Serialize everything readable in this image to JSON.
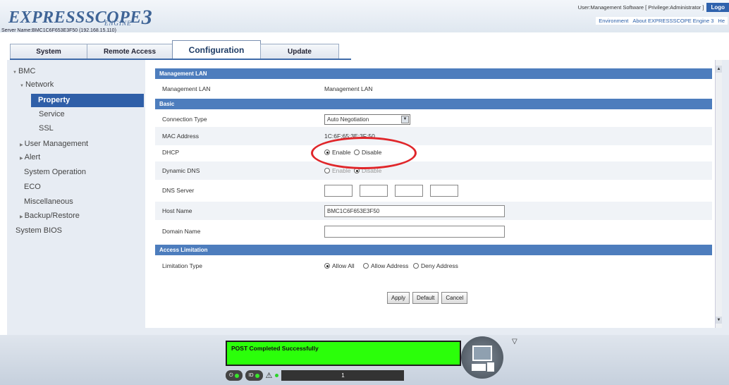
{
  "header": {
    "logo_main": "EXPRESSSCOPE",
    "logo_num": "3",
    "logo_sub": "ENGINE",
    "server_name": "Server Name:BMC1C6F653E3F50 (192.168.15.110)",
    "user_info": "User:Management Software [ Privilege:Administrator ]",
    "logout_label": "Logo",
    "links": [
      "Environment",
      "About EXPRESSSCOPE Engine 3",
      "He"
    ]
  },
  "tabs": [
    {
      "label": "System"
    },
    {
      "label": "Remote Access"
    },
    {
      "label": "Configuration"
    },
    {
      "label": "Update"
    }
  ],
  "sidebar": {
    "items": [
      {
        "label": "BMC"
      },
      {
        "label": "Network"
      },
      {
        "label": "Property"
      },
      {
        "label": "Service"
      },
      {
        "label": "SSL"
      },
      {
        "label": "User Management"
      },
      {
        "label": "Alert"
      },
      {
        "label": "System Operation"
      },
      {
        "label": "ECO"
      },
      {
        "label": "Miscellaneous"
      },
      {
        "label": "Backup/Restore"
      },
      {
        "label": "System BIOS"
      }
    ]
  },
  "content": {
    "sections": [
      {
        "title": "Management LAN"
      },
      {
        "title": "Basic"
      },
      {
        "title": "Access Limitation"
      }
    ],
    "management_lan": {
      "label": "Management LAN",
      "value": "Management LAN"
    },
    "connection_type": {
      "label": "Connection Type",
      "value": "Auto Negotiation"
    },
    "mac_address": {
      "label": "MAC Address",
      "value": "1C:6F:65:3E:3F:50"
    },
    "dhcp": {
      "label": "DHCP",
      "options": [
        "Enable",
        "Disable"
      ],
      "selected": "Enable"
    },
    "dynamic_dns": {
      "label": "Dynamic DNS",
      "options": [
        "Enable",
        "Disable"
      ]
    },
    "dns_server": {
      "label": "DNS Server"
    },
    "host_name": {
      "label": "Host Name",
      "value": "BMC1C6F653E3F50"
    },
    "domain_name": {
      "label": "Domain Name",
      "value": ""
    },
    "limitation_type": {
      "label": "Limitation Type",
      "options": [
        "Allow All",
        "Allow Address",
        "Deny Address"
      ],
      "selected": "Allow All"
    },
    "buttons": {
      "apply": "Apply",
      "default": "Default",
      "cancel": "Cancel"
    }
  },
  "status": {
    "post_message": "POST Completed Successfully",
    "power_label": "",
    "id_label": "ID",
    "bar_label": "1"
  },
  "colors": {
    "accent": "#2f5fa8",
    "section_header": "#4d7dbd",
    "post_green": "#2bff0a",
    "highlight_circle": "#e0262a"
  }
}
